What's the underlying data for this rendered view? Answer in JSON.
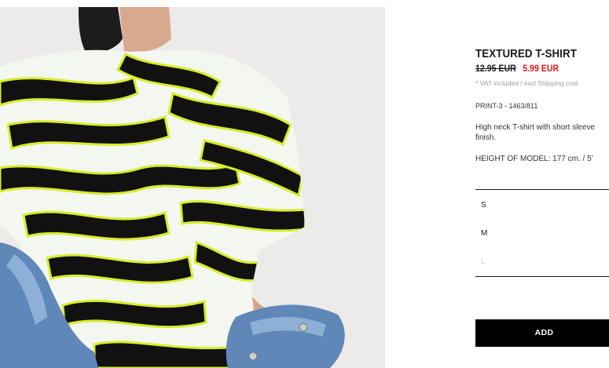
{
  "product": {
    "title": "TEXTURED T-SHIRT",
    "old_price": "12.95 EUR",
    "sale_price": "5.99 EUR",
    "vat_note": "* VAT included / excl Shipping cost",
    "reference": "PRINT-3 - 1463/811",
    "description": "High neck T-shirt with short sleeve finish.",
    "model_height": "HEIGHT OF MODEL: 177 cm. / 5'"
  },
  "sizes": [
    {
      "label": "S",
      "available": true
    },
    {
      "label": "M",
      "available": true
    },
    {
      "label": "L",
      "available": false
    }
  ],
  "add_button_label": "ADD",
  "colors": {
    "sale": "#e0151c",
    "button": "#000000",
    "print_accent": "#d8ec2a"
  }
}
